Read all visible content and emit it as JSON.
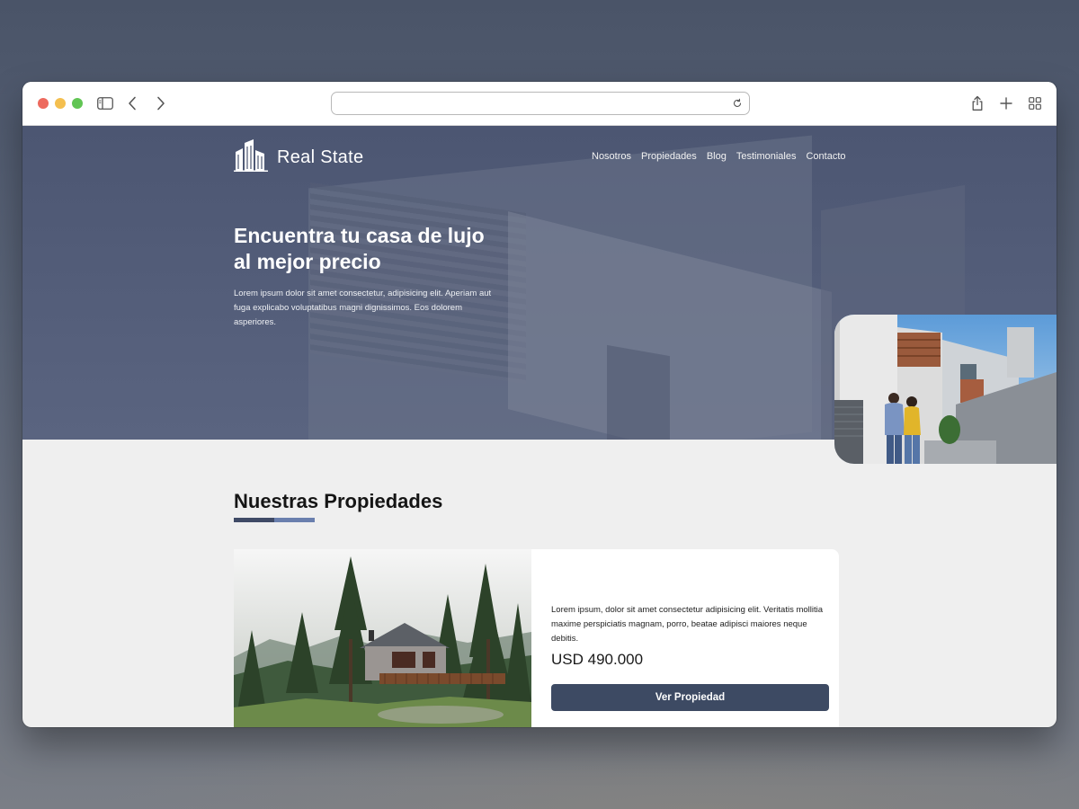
{
  "browser": {
    "url": ""
  },
  "site": {
    "logo_text": "Real State",
    "nav": [
      "Nosotros",
      "Propiedades",
      "Blog",
      "Testimoniales",
      "Contacto"
    ]
  },
  "hero": {
    "title": "Encuentra tu casa de lujo al mejor precio",
    "text": "Lorem ipsum dolor sit amet consectetur, adipisicing elit. Aperiam aut fuga explicabo voluptatibus magni dignissimos. Eos dolorem asperiores."
  },
  "properties": {
    "title_light": "Nuestras",
    "title_bold": "Propiedades",
    "card": {
      "description": "Lorem ipsum, dolor sit amet consectetur adipisicing elit. Veritatis mollitia maxime perspiciatis magnam, porro, beatae adipisci maiores neque debitis.",
      "price": "USD 490.000",
      "button": "Ver Propiedad"
    }
  },
  "colors": {
    "hero_overlay": "#4c5672",
    "accent_dark": "#3d4a63",
    "accent_light": "#6a7fae",
    "page_background": "#efefef"
  }
}
